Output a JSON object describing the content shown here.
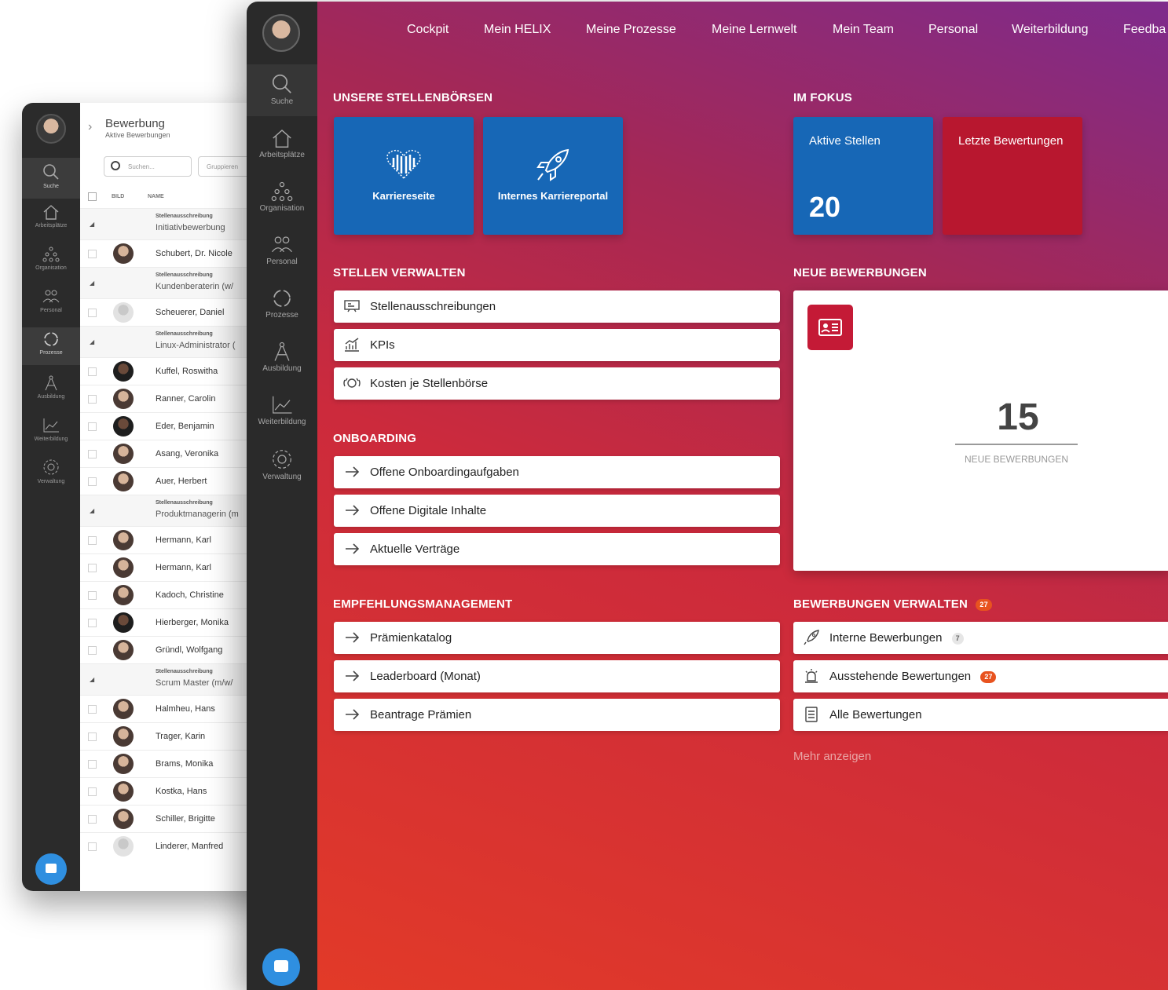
{
  "back_window": {
    "rail": [
      {
        "label": "Suche",
        "icon": "search-icon"
      },
      {
        "label": "Arbeitsplätze",
        "icon": "home-icon"
      },
      {
        "label": "Organisation",
        "icon": "org-icon"
      },
      {
        "label": "Personal",
        "icon": "people-icon"
      },
      {
        "label": "Prozesse",
        "icon": "process-icon"
      },
      {
        "label": "Ausbildung",
        "icon": "compass-icon"
      },
      {
        "label": "Weiterbildung",
        "icon": "chart-icon"
      },
      {
        "label": "Verwaltung",
        "icon": "gear-icon"
      }
    ],
    "title": "Bewerbung",
    "subtitle": "Aktive Bewerbungen",
    "search_placeholder": "Suchen...",
    "group_placeholder": "Gruppieren",
    "columns": {
      "bild": "BILD",
      "name": "NAME"
    },
    "rows": [
      {
        "type": "group",
        "label": "Stellenausschreibung",
        "title": "Initiativbewerbung"
      },
      {
        "type": "person",
        "name": "Schubert, Dr. Nicole"
      },
      {
        "type": "group",
        "label": "Stellenausschreibung",
        "title": "Kundenberaterin (w/"
      },
      {
        "type": "person",
        "name": "Scheuerer, Daniel"
      },
      {
        "type": "group",
        "label": "Stellenausschreibung",
        "title": "Linux-Administrator ("
      },
      {
        "type": "person",
        "name": "Kuffel, Roswitha"
      },
      {
        "type": "person",
        "name": "Ranner, Carolin"
      },
      {
        "type": "person",
        "name": "Eder, Benjamin"
      },
      {
        "type": "person",
        "name": "Asang, Veronika"
      },
      {
        "type": "person",
        "name": "Auer, Herbert"
      },
      {
        "type": "group",
        "label": "Stellenausschreibung",
        "title": "Produktmanagerin (m"
      },
      {
        "type": "person",
        "name": "Hermann, Karl"
      },
      {
        "type": "person",
        "name": "Hermann, Karl"
      },
      {
        "type": "person",
        "name": "Kadoch, Christine"
      },
      {
        "type": "person",
        "name": "Hierberger, Monika"
      },
      {
        "type": "person",
        "name": "Gründl, Wolfgang"
      },
      {
        "type": "group",
        "label": "Stellenausschreibung",
        "title": "Scrum Master (m/w/"
      },
      {
        "type": "person",
        "name": "Halmheu, Hans"
      },
      {
        "type": "person",
        "name": "Trager, Karin"
      },
      {
        "type": "person",
        "name": "Brams, Monika"
      },
      {
        "type": "person",
        "name": "Kostka, Hans"
      },
      {
        "type": "person",
        "name": "Schiller, Brigitte"
      },
      {
        "type": "person",
        "name": "Linderer, Manfred"
      }
    ]
  },
  "front_window": {
    "rail": [
      {
        "label": "Suche",
        "icon": "search-icon"
      },
      {
        "label": "Arbeitsplätze",
        "icon": "home-icon"
      },
      {
        "label": "Organisation",
        "icon": "org-icon"
      },
      {
        "label": "Personal",
        "icon": "people-icon"
      },
      {
        "label": "Prozesse",
        "icon": "process-icon"
      },
      {
        "label": "Ausbildung",
        "icon": "compass-icon"
      },
      {
        "label": "Weiterbildung",
        "icon": "chart-icon"
      },
      {
        "label": "Verwaltung",
        "icon": "gear-icon"
      }
    ],
    "nav": [
      "Cockpit",
      "Mein HELIX",
      "Meine Prozesse",
      "Meine Lernwelt",
      "Mein Team",
      "Personal",
      "Weiterbildung",
      "Feedba"
    ],
    "stellenboersen": {
      "title": "UNSERE STELLENBÖRSEN",
      "tiles": [
        {
          "label": "Karriereseite",
          "icon": "heart-grid-icon"
        },
        {
          "label": "Internes Karriereportal",
          "icon": "rocket-icon"
        }
      ]
    },
    "fokus": {
      "title": "IM FOKUS",
      "tiles": [
        {
          "label": "Aktive Stellen",
          "value": "20",
          "color": "#1767b6"
        },
        {
          "label": "Letzte Bewertungen",
          "value": "",
          "color": "#b8172f"
        }
      ]
    },
    "stellen_verwalten": {
      "title": "STELLEN VERWALTEN",
      "items": [
        {
          "label": "Stellenausschreibungen",
          "icon": "board-icon"
        },
        {
          "label": "KPIs",
          "icon": "kpi-chart-icon"
        },
        {
          "label": "Kosten je Stellenbörse",
          "icon": "coins-icon"
        }
      ]
    },
    "neue_bewerbungen": {
      "title": "NEUE BEWERBUNGEN",
      "value": "15",
      "caption": "NEUE BEWERBUNGEN"
    },
    "onboarding": {
      "title": "ONBOARDING",
      "items": [
        "Offene Onboardingaufgaben",
        "Offene Digitale Inhalte",
        "Aktuelle Verträge"
      ]
    },
    "empfehlung": {
      "title": "EMPFEHLUNGSMANAGEMENT",
      "items": [
        "Prämienkatalog",
        "Leaderboard (Monat)",
        "Beantrage Prämien"
      ]
    },
    "bewerbungen_verwalten": {
      "title": "BEWERBUNGEN VERWALTEN",
      "badge": "27",
      "items": [
        {
          "label": "Interne Bewerbungen",
          "badge": "7",
          "badge_style": "grey",
          "icon": "rocket-icon"
        },
        {
          "label": "Ausstehende Bewertungen",
          "badge": "27",
          "badge_style": "orange",
          "icon": "alarm-icon"
        },
        {
          "label": "Alle Bewertungen",
          "badge": "",
          "badge_style": "",
          "icon": "list-icon"
        }
      ],
      "more": "Mehr anzeigen"
    }
  }
}
